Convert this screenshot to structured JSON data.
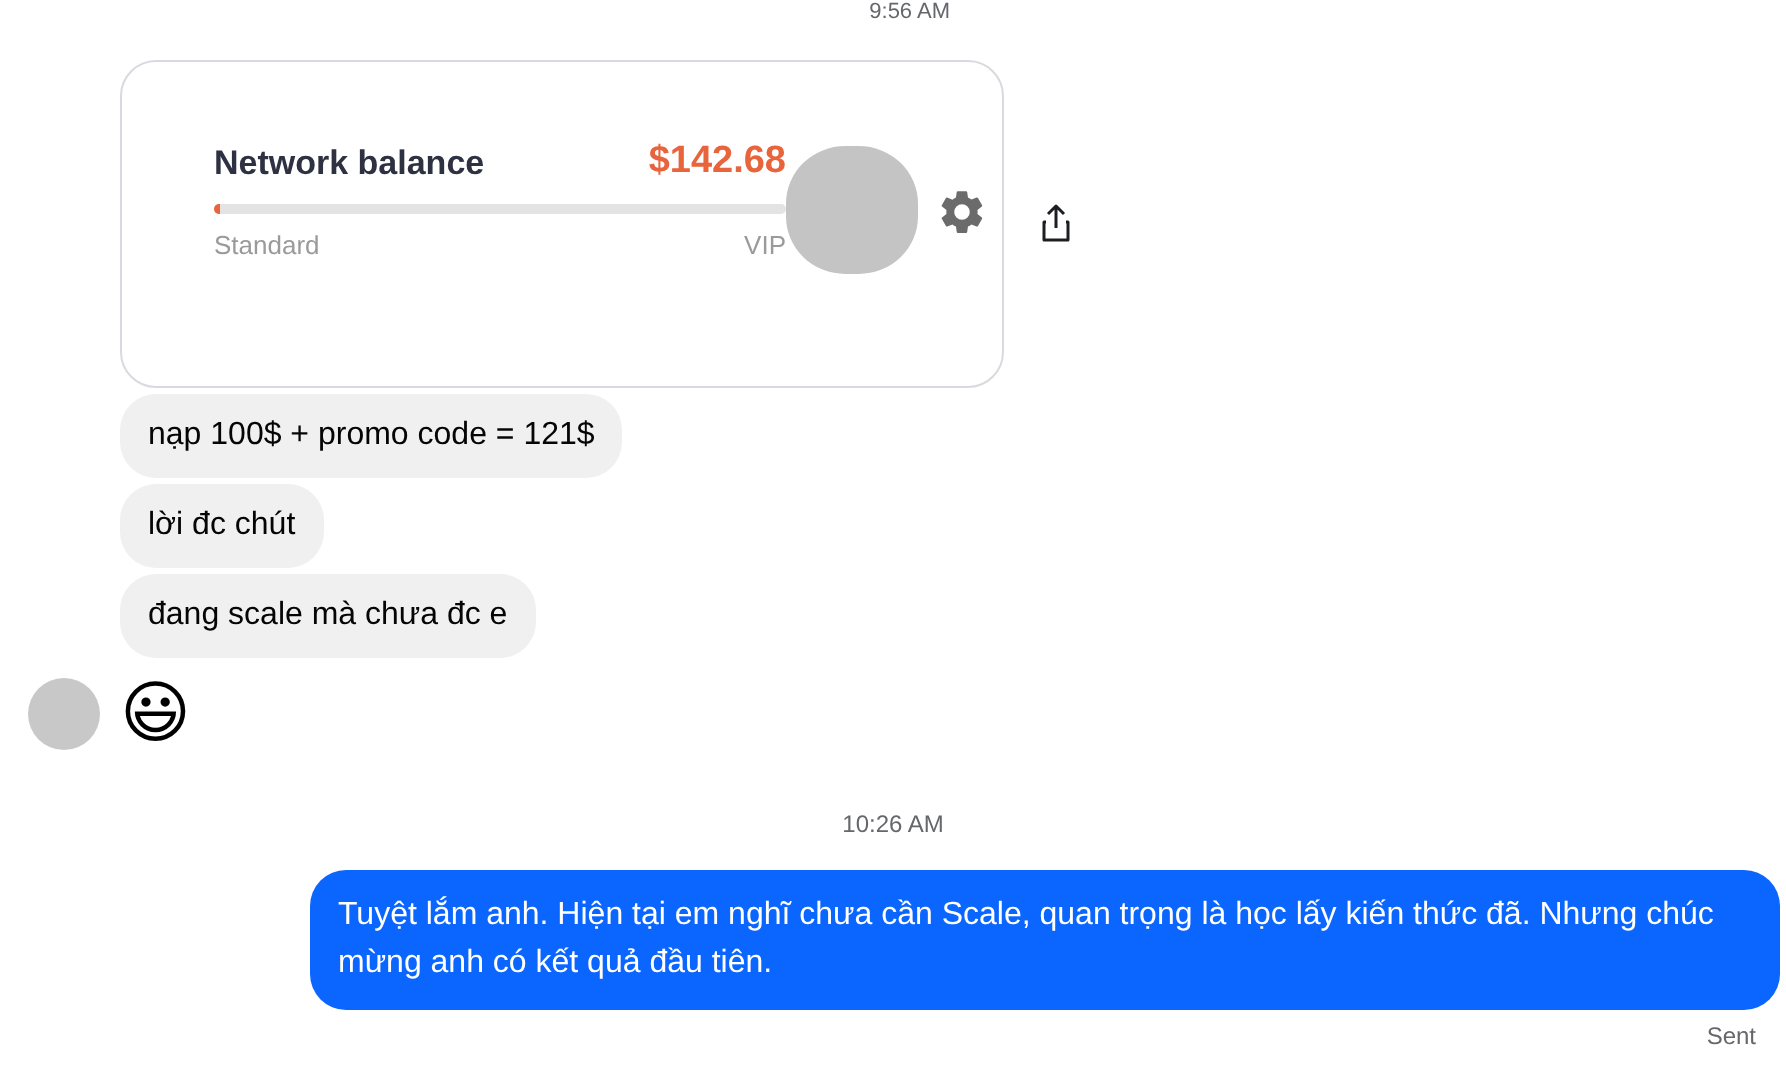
{
  "timestamp_top": "9:56 AM",
  "balance_card": {
    "title": "Network balance",
    "amount": "$142.68",
    "level": 0.01,
    "min_label": "Standard",
    "max_label": "VIP"
  },
  "received_messages": [
    {
      "kind": "text",
      "text": "nạp 100$ + promo code = 121$"
    },
    {
      "kind": "text",
      "text": "lời đc chút"
    },
    {
      "kind": "text",
      "text": "đang scale mà chưa đc e"
    },
    {
      "kind": "emoji",
      "text": "😃"
    }
  ],
  "timestamp": "10:26 AM",
  "sent_message": {
    "text": "Tuyệt lắm anh. Hiện tại em nghĩ chưa cần Scale, quan trọng là học lấy kiến thức đã. Nhưng chúc mừng anh có kết quả đầu tiên.",
    "status": "Sent"
  }
}
